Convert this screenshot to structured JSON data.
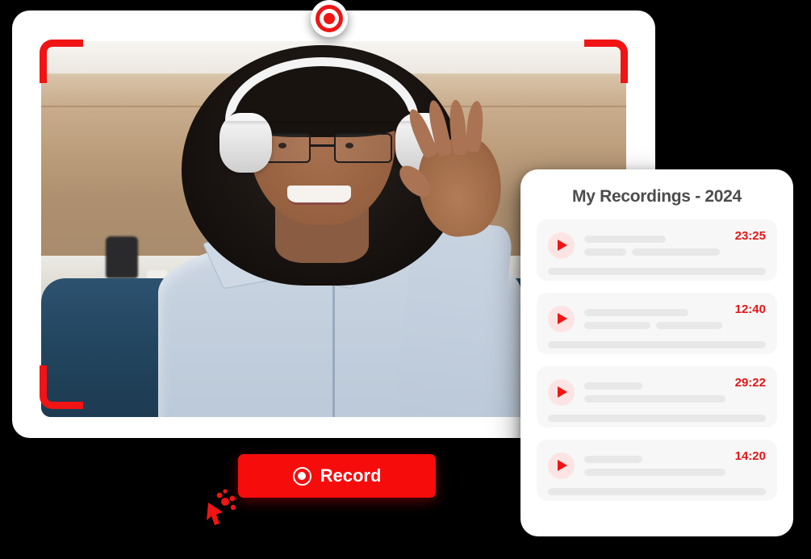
{
  "recorder": {
    "record_indicator_name": "record-indicator",
    "record_button_label": "Record",
    "record_icon": "record-circle-icon",
    "cursor_icon": "click-cursor-icon",
    "brackets": [
      "top-left",
      "top-right",
      "bottom-left"
    ],
    "frame_accent_color": "#f01414",
    "button_color": "#f70c0c"
  },
  "panel": {
    "title": "My Recordings - 2024",
    "title_color": "#4c4c4c",
    "time_color": "#e51515",
    "play_icon": "play-icon",
    "items": [
      {
        "time": "23:25",
        "line_widths": [
          "58%",
          "30%",
          "62%"
        ],
        "bottom_width": "100%"
      },
      {
        "time": "12:40",
        "line_widths": [
          "74%",
          "47%",
          "47%"
        ],
        "bottom_width": "100%"
      },
      {
        "time": "29:22",
        "line_widths": [
          "41%",
          "100%"
        ],
        "bottom_width": "100%"
      },
      {
        "time": "14:20",
        "line_widths": [
          "41%",
          "100%"
        ],
        "bottom_width": "100%"
      }
    ]
  }
}
